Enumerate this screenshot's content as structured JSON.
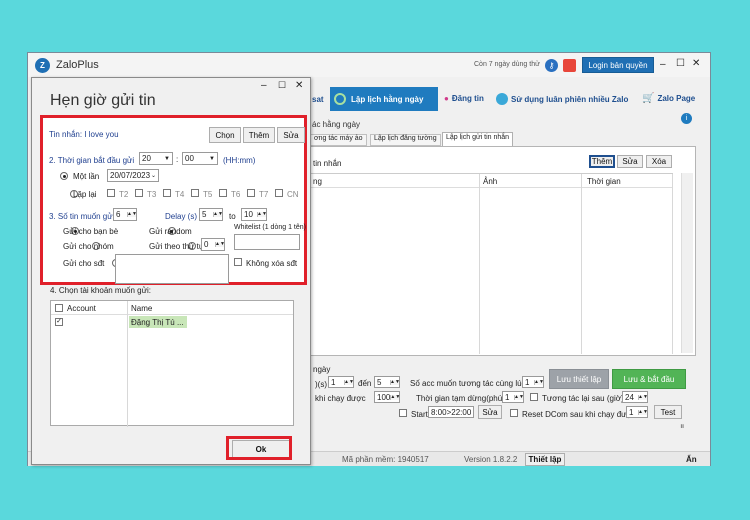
{
  "main": {
    "title": "ZaloPlus",
    "trial": "Còn 7 ngày dùng thử",
    "login": "Login bản quyền",
    "nav": [
      "sat",
      "Lập lịch hằng ngày",
      "Đăng tin",
      "Sử dụng luân phiên nhiều Zalo",
      "Zalo Page"
    ],
    "section": "ác hằng ngày",
    "tabs": [
      "ơng tác máy ảo",
      "Lập lịch đăng tường",
      "Lập lịch gửi tin nhắn"
    ],
    "panel_label": "tin nhắn",
    "panel_buttons": [
      "Thêm",
      "Sửa",
      "Xóa"
    ],
    "columns": [
      "ng",
      "Ảnh",
      "Thời gian"
    ],
    "bottom": {
      "label_ngay": "ngày",
      "tu_value": "1",
      "den_label": "đến",
      "den_value": "5",
      "khi_chay": "khi chạy được",
      "khi_value": "100",
      "acc_label": "Số acc muốn tương tác cùng lúc",
      "acc_value": "1",
      "pause_label": "Thời gian tạm dừng(phút)",
      "pause_value": "1",
      "repeat_label": "Tương tác lại sau (giờ)",
      "repeat_value": "24",
      "start_label": "Start",
      "start_value": "8:00>22:00",
      "sua": "Sửa",
      "reset_label": "Reset DCom sau khi chạy được",
      "reset_value": "1",
      "test": "Test",
      "save": "Lưu thiết lập",
      "save_run": "Lưu & bắt đầu"
    },
    "status": {
      "machine": "Mã phần mềm: 1940517",
      "version": "Version 1.8.2.2",
      "settings": "Thiết lập",
      "an": "Ẩn"
    }
  },
  "dialog": {
    "title": "Hẹn giờ gửi tin",
    "message_label": "Tin nhắn: I love you",
    "btn_choose": "Chọn",
    "btn_add": "Thêm",
    "btn_edit": "Sửa",
    "start_label": "2. Thời gian bắt đầu gửi",
    "hour": "20",
    "minute": "00",
    "hhmm": "(HH:mm)",
    "once": "Một lần",
    "date": "20/07/2023",
    "repeat": "Lặp lại",
    "days": [
      "T2",
      "T3",
      "T4",
      "T5",
      "T6",
      "T7",
      "CN"
    ],
    "count_label": "3. Số tin muốn gửi",
    "count": "6",
    "delay_label": "Delay (s)",
    "delay_from": "5",
    "to": "to",
    "delay_to": "10",
    "send_friends": "Gửi cho bạn bè",
    "send_random": "Gửi random",
    "whitelist": "Whitelist (1 dòng 1 tên)",
    "send_group": "Gửi cho nhóm",
    "send_order": "Gửi theo thứ tự",
    "order_value": "0",
    "send_phone": "Gửi cho sđt",
    "no_delete_phone": "Không xóa sđt",
    "account_label": "4. Chọn tài khoản muốn gửi:",
    "col_account": "Account",
    "col_name": "Name",
    "account_name": "Đặng Thị Tú ...",
    "ok": "Ok"
  },
  "colors": {
    "highlight": "#e0202a",
    "primary": "#1f7bbf",
    "green": "#52b456",
    "bg": "#5ad8dc"
  }
}
